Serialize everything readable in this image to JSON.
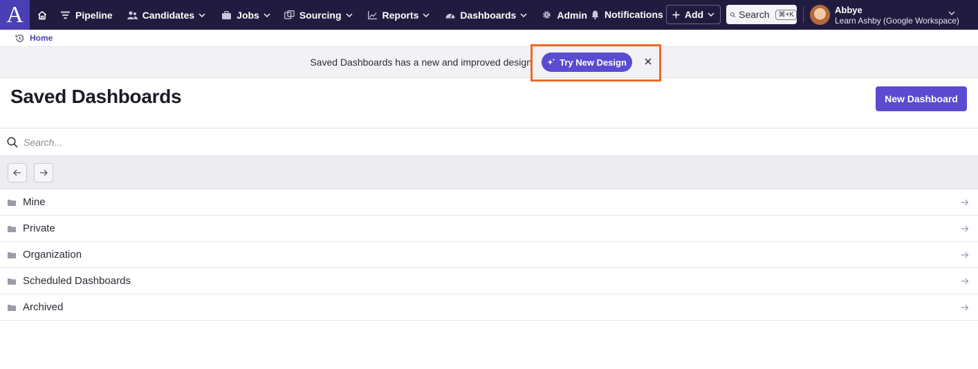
{
  "app": {
    "logo_letter": "A",
    "brand_color": "#4b3fb5",
    "nav_bg": "#211c3f",
    "accent": "#5b4bd0",
    "highlight": "#ee6a23"
  },
  "nav": {
    "items": [
      {
        "label": "Pipeline",
        "icon": "filter-icon",
        "dropdown": false
      },
      {
        "label": "Candidates",
        "icon": "people-icon",
        "dropdown": true
      },
      {
        "label": "Jobs",
        "icon": "briefcase-icon",
        "dropdown": true
      },
      {
        "label": "Sourcing",
        "icon": "sourcing-icon",
        "dropdown": true
      },
      {
        "label": "Reports",
        "icon": "chart-line-icon",
        "dropdown": true
      },
      {
        "label": "Dashboards",
        "icon": "gauge-icon",
        "dropdown": true
      },
      {
        "label": "Admin",
        "icon": "gear-icon",
        "dropdown": false
      }
    ],
    "notifications_label": "Notifications",
    "add_label": "Add",
    "search_label": "Search",
    "search_shortcut": "⌘+K",
    "user_name": "Abbye",
    "user_org": "Learn Ashby (Google Workspace)"
  },
  "breadcrumb": {
    "home_label": "Home"
  },
  "banner": {
    "text": "Saved Dashboards has a new and improved design",
    "button_label": "Try New Design"
  },
  "header": {
    "title": "Saved Dashboards",
    "new_button_label": "New Dashboard"
  },
  "search": {
    "placeholder": "Search..."
  },
  "folders": [
    {
      "label": "Mine"
    },
    {
      "label": "Private"
    },
    {
      "label": "Organization"
    },
    {
      "label": "Scheduled Dashboards"
    },
    {
      "label": "Archived"
    }
  ]
}
